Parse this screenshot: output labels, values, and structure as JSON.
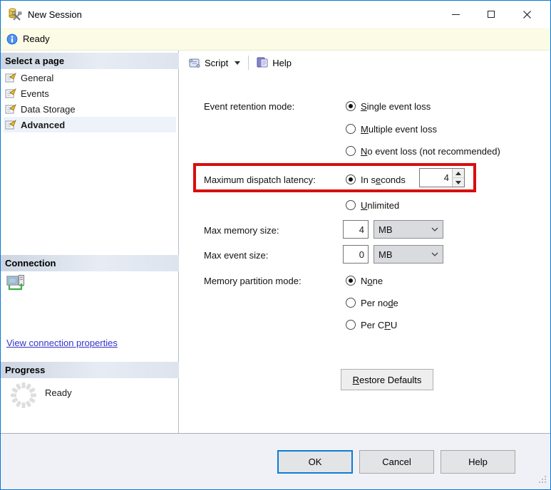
{
  "window": {
    "title": "New Session"
  },
  "status_bar": {
    "text": "Ready"
  },
  "sidebar": {
    "select_page_header": "Select a page",
    "pages": [
      {
        "label": "General",
        "selected": false
      },
      {
        "label": "Events",
        "selected": false
      },
      {
        "label": "Data Storage",
        "selected": false
      },
      {
        "label": "Advanced",
        "selected": true
      }
    ],
    "connection_header": "Connection",
    "connection_link": "View connection properties",
    "progress_header": "Progress",
    "progress_status": "Ready"
  },
  "toolbar": {
    "script_label": "Script",
    "help_label": "Help"
  },
  "form": {
    "event_retention": {
      "label": "Event retention mode:",
      "options": [
        {
          "pre": "",
          "key": "S",
          "post": "ingle event loss",
          "selected": true
        },
        {
          "pre": "",
          "key": "M",
          "post": "ultiple event loss",
          "selected": false
        },
        {
          "pre": "",
          "key": "N",
          "post": "o event loss (not recommended)",
          "selected": false
        }
      ]
    },
    "dispatch": {
      "label": "Maximum dispatch latency:",
      "in_seconds": {
        "pre": "In s",
        "key": "e",
        "post": "conds",
        "selected": true
      },
      "value": "4",
      "unlimited": {
        "pre": "",
        "key": "U",
        "post": "nlimited",
        "selected": false
      }
    },
    "max_memory": {
      "label": "Max memory size:",
      "value": "4",
      "unit": "MB"
    },
    "max_event": {
      "label": "Max event size:",
      "value": "0",
      "unit": "MB"
    },
    "partition": {
      "label": "Memory partition mode:",
      "options": [
        {
          "pre": "N",
          "key": "o",
          "post": "ne",
          "selected": true
        },
        {
          "pre": "Per no",
          "key": "d",
          "post": "e",
          "selected": false
        },
        {
          "pre": "Per C",
          "key": "P",
          "post": "U",
          "selected": false
        }
      ]
    },
    "restore_defaults": {
      "pre": "",
      "key": "R",
      "post": "estore Defaults"
    }
  },
  "footer": {
    "ok": "OK",
    "cancel": "Cancel",
    "help": "Help"
  },
  "colors": {
    "accent": "#0078d7",
    "highlight_red": "#d90e0e",
    "link": "#3333cc",
    "status_bg": "#fbfbe6"
  }
}
